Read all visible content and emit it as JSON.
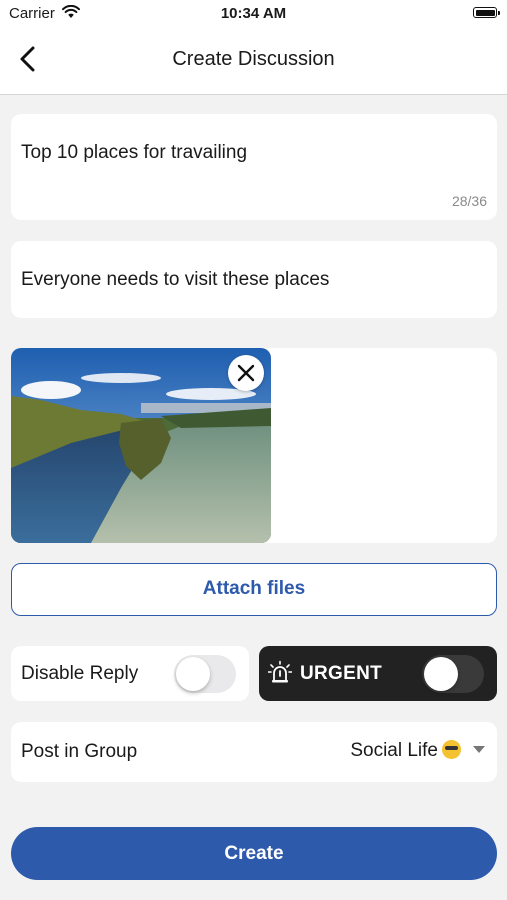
{
  "status_bar": {
    "carrier": "Carrier",
    "time": "10:34 AM"
  },
  "nav": {
    "title": "Create Discussion",
    "back_icon": "chevron-left-icon"
  },
  "form": {
    "title_value": "Top 10 places for travailing",
    "title_counter": "28/36",
    "description_value": "Everyone needs to visit these places",
    "attachment": {
      "remove_icon": "close-icon"
    },
    "attach_label": "Attach files",
    "disable_reply": {
      "label": "Disable Reply",
      "enabled": false
    },
    "urgent": {
      "label": "URGENT",
      "enabled": false,
      "icon": "alarm-siren-icon"
    },
    "group": {
      "label": "Post in Group",
      "selected": "Social Life"
    },
    "create_label": "Create"
  },
  "colors": {
    "accent": "#2e5aac",
    "urgent_bg": "#222222",
    "background": "#f2f2f2"
  }
}
